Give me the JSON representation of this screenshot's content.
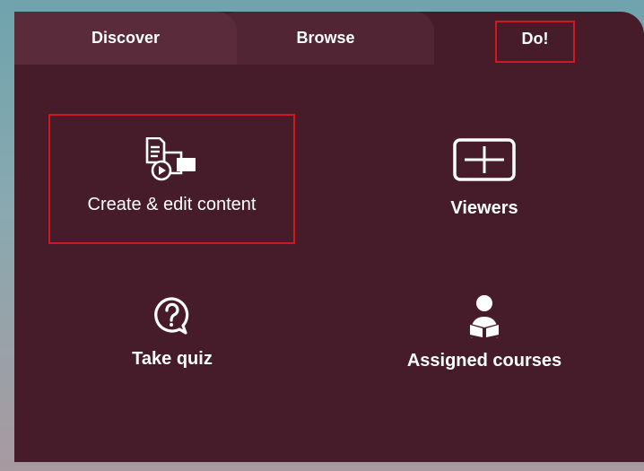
{
  "tabs": [
    {
      "label": "Discover",
      "active": false
    },
    {
      "label": "Browse",
      "active": false
    },
    {
      "label": "Do!",
      "active": true
    }
  ],
  "tiles": [
    {
      "label": "Create & edit content",
      "icon": "create-edit-content-icon"
    },
    {
      "label": "Viewers",
      "icon": "viewers-icon"
    },
    {
      "label": "Take quiz",
      "icon": "question-bubble-icon"
    },
    {
      "label": "Assigned courses",
      "icon": "reader-icon"
    }
  ],
  "colors": {
    "panel": "#461c2a",
    "tab_discover": "#5a2b3b",
    "tab_browse": "#522535",
    "highlight": "#d11820",
    "text": "#ffffff"
  }
}
